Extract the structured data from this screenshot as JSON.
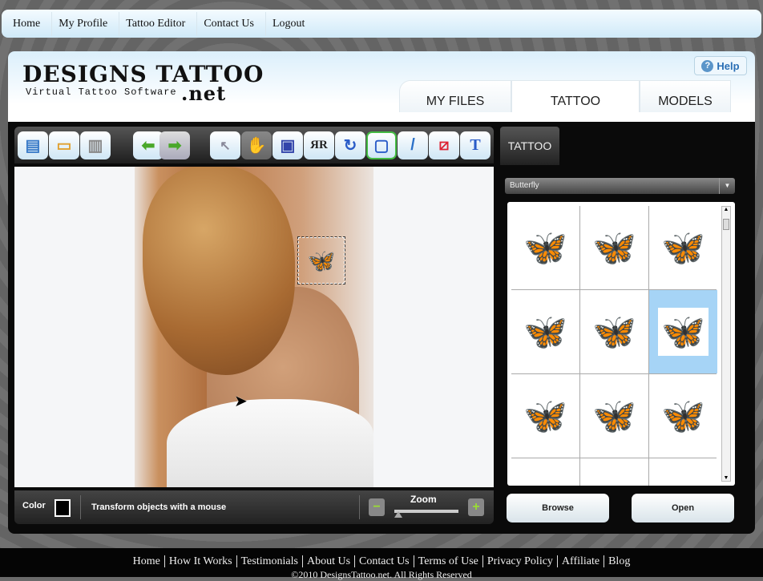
{
  "topnav": [
    "Home",
    "My Profile",
    "Tattoo Editor",
    "Contact Us",
    "Logout"
  ],
  "logo": {
    "title": "DESIGNS TATTOO",
    "net": ".net",
    "tagline": "Virtual Tattoo Software"
  },
  "help": "Help",
  "tabs": [
    "MY FILES",
    "TATTOO",
    "MODELS"
  ],
  "active_tab": "TATTOO",
  "toolbar": [
    "save-icon",
    "print-icon",
    "trash-icon",
    "undo-arrow-icon",
    "redo-arrow-icon",
    "pointer-icon",
    "hand-icon",
    "frame-icon",
    "mirror-icon",
    "rotate-icon",
    "fit-icon",
    "brush-icon",
    "eraser-icon",
    "text-icon"
  ],
  "bottom": {
    "color_label": "Color",
    "status": "Transform objects with a mouse",
    "zoom_label": "Zoom",
    "zoom_level": 0.05
  },
  "panel": {
    "tab": "TATTOO",
    "category": "Butterfly",
    "browse": "Browse",
    "open": "Open",
    "selected_index": 5
  },
  "footer": {
    "links": [
      "Home",
      "How It Works",
      "Testimonials",
      "About Us",
      "Contact Us",
      "Terms of Use",
      "Privacy Policy",
      "Affiliate",
      "Blog"
    ],
    "copyright": "©2010 DesignsTattoo.net. All Rights Reserved"
  }
}
